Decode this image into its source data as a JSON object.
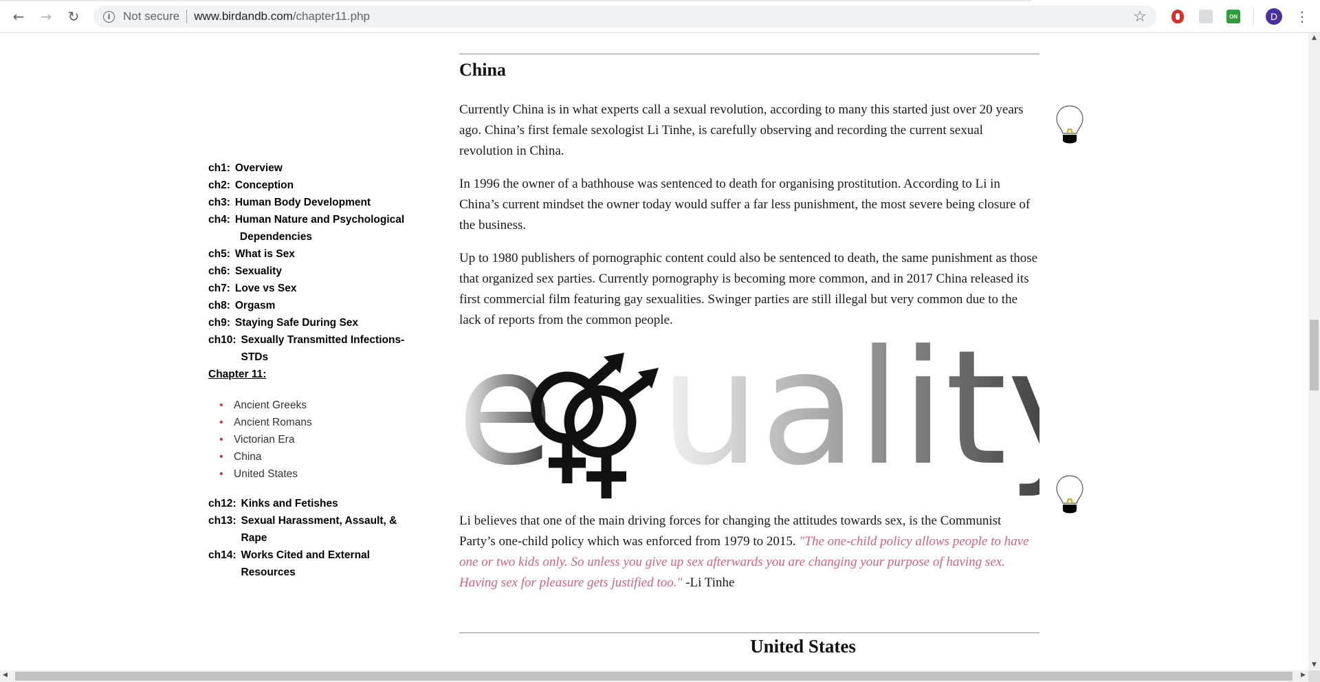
{
  "browser": {
    "back_icon": "←",
    "forward_icon": "→",
    "reload_icon": "↻",
    "security_label": "Not secure",
    "url_host": "www.birdandb.com",
    "url_path": "/chapter11.php",
    "bookmark_icon": "☆",
    "extension_on_label": "ON",
    "avatar_letter": "D",
    "menu_icon": "⋮"
  },
  "sidebar": {
    "chapters_before": [
      {
        "num": "ch1:",
        "title": "Overview"
      },
      {
        "num": "ch2:",
        "title": "Conception"
      },
      {
        "num": "ch3:",
        "title": "Human Body Development"
      },
      {
        "num": "ch4:",
        "title": "Human Nature and Psychological Dependencies"
      },
      {
        "num": "ch5:",
        "title": "What is Sex"
      },
      {
        "num": "ch6:",
        "title": "Sexuality"
      },
      {
        "num": "ch7:",
        "title": "Love vs Sex"
      },
      {
        "num": "ch8:",
        "title": "Orgasm"
      },
      {
        "num": "ch9:",
        "title": "Staying Safe During Sex"
      },
      {
        "num": "ch10:",
        "title": "Sexually Transmitted Infections-STDs"
      }
    ],
    "current_chapter": "Chapter 11:",
    "sections": [
      "Ancient Greeks",
      "Ancient Romans",
      "Victorian Era",
      "China",
      "United States"
    ],
    "chapters_after": [
      {
        "num": "ch12:",
        "title": "Kinks and Fetishes"
      },
      {
        "num": "ch13:",
        "title": "Sexual Harassment, Assault, & Rape"
      },
      {
        "num": "ch14:",
        "title": "Works Cited and External Resources"
      }
    ]
  },
  "content": {
    "china_heading": "China",
    "paragraph_1": "Currently China is in what experts call a sexual revolution, according to many this started just over 20 years ago. China’s first female sexologist Li Tinhe, is carefully observing and recording the current sexual revolution in China.",
    "paragraph_2": "In 1996 the owner of a bathhouse was sentenced to death for organising prostitution. According to Li in China’s current mindset the owner today would suffer a far less punishment, the most severe being closure of the business.",
    "paragraph_3": "Up to 1980 publishers of pornographic content could also be sentenced to death, the same punishment as those that organized sex parties. Currently pornography is becoming more common, and in 2017 China released its first commercial film featuring gay sexualities. Swinger parties are still illegal but very common due to the lack of reports from the common people.",
    "equality_image": {
      "letter_e": "e",
      "letters_rest": "uality",
      "symbol_icon": "combined-gender-symbols-icon"
    },
    "paragraph_4_text": "Li believes that one of the main driving forces for changing the attitudes towards sex, is the Communist Party’s one-child policy which was enforced from 1979 to 2015. ",
    "paragraph_4_quote": "\"The one-child policy allows people to have one or two kids only. So unless you give up sex afterwards you are changing your purpose of having sex. Having sex for pleasure gets justified too.\"",
    "paragraph_4_attribution": " -Li Tinhe",
    "united_states_heading": "United States"
  },
  "colors": {
    "quote": "#d4627e",
    "bullet": "#c0394b",
    "avatar": "#4a2fa3"
  }
}
